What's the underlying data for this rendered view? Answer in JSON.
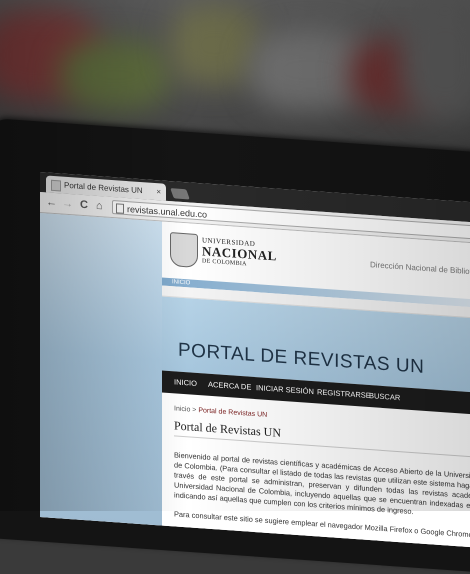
{
  "browser": {
    "tab_title": "Portal de Revistas UN",
    "tab_close": "×",
    "back_glyph": "←",
    "forward_glyph": "→",
    "reload_glyph": "C",
    "home_glyph": "⌂",
    "url": "revistas.unal.edu.co"
  },
  "header": {
    "logo_line1": "UNIVERSIDAD",
    "logo_line2": "NACIONAL",
    "logo_line3": "DE COLOMBIA",
    "right_text": "Dirección Nacional de Bibliotecas"
  },
  "inicio_bar": "INICIO",
  "banner_title": "PORTAL DE REVISTAS UN",
  "nav": [
    {
      "label": "INICIO"
    },
    {
      "label": "ACERCA DE"
    },
    {
      "label": "INICIAR SESIÓN"
    },
    {
      "label": "REGISTRARSE"
    },
    {
      "label": "BUSCAR"
    }
  ],
  "breadcrumb": {
    "home": "Inicio",
    "separator": " > ",
    "current": "Portal de Revistas UN"
  },
  "page_title": "Portal de Revistas UN",
  "intro": "Bienvenido al portal de revistas científicas y académicas de Acceso Abierto de la Universidad Nacional de Colombia. (Para consultar el listado de todas las revistas que utilizan este sistema haga clic aquí). A través de este portal se administran, preservan y difunden todas las revistas académicas de la Universidad Nacional de Colombia, incluyendo aquellas que se encuentran indexadas en Publindexo indicando así aquellas que cumplen con los criterios mínimos de ingreso.",
  "intro2": "Para consultar este sitio se sugiere emplear el navegador Mozilla Firefox o Google Chrome"
}
